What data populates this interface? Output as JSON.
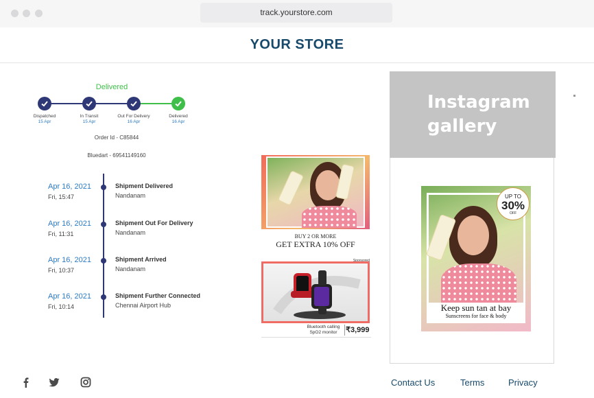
{
  "browser": {
    "url": "track.yourstore.com"
  },
  "header": {
    "brand": "YOUR STORE"
  },
  "tracker": {
    "status_label": "Delivered",
    "steps": [
      {
        "name": "Dispatched",
        "date": "15 Apr",
        "state": "done"
      },
      {
        "name": "In Transit",
        "date": "15 Apr",
        "state": "done"
      },
      {
        "name": "Out For Delivery",
        "date": "16 Apr",
        "state": "done"
      },
      {
        "name": "Delivered",
        "date": "16 Apr",
        "state": "delivered"
      }
    ],
    "order_id": "Order Id - C85844",
    "courier": "Bluedart - 69541149160",
    "colors": {
      "done": "#2f3876",
      "delivered": "#3fbf4a"
    }
  },
  "timeline": [
    {
      "date": "Apr 16, 2021",
      "time": "Fri, 15:47",
      "title": "Shipment Delivered",
      "place": "Nandanam"
    },
    {
      "date": "Apr 16, 2021",
      "time": "Fri, 11:31",
      "title": "Shipment Out For Delivery",
      "place": "Nandanam"
    },
    {
      "date": "Apr 16, 2021",
      "time": "Fri, 10:37",
      "title": "Shipment Arrived",
      "place": "Nandanam"
    },
    {
      "date": "Apr 16, 2021",
      "time": "Fri, 10:14",
      "title": "Shipment Further Connected",
      "place": "Chennai Airport Hub"
    }
  ],
  "ads": {
    "sunscreen": {
      "line1": "BUY 2 OR MORE",
      "line2": "GET EXTRA 10% OFF"
    },
    "watch": {
      "sponsored": "Sponsored",
      "caption_line1": "Bluetooth calling",
      "caption_line2": "SpO2 monitor",
      "price": "₹3,999"
    }
  },
  "instagram": {
    "title": "Instagram gallery",
    "post": {
      "badge_top": "UP TO",
      "badge_pct": "30%",
      "badge_off": "OFF",
      "caption": "Keep sun tan at bay",
      "subcaption": "Sunscreens for face & body"
    }
  },
  "footer": {
    "social": [
      "facebook-icon",
      "twitter-icon",
      "instagram-icon"
    ],
    "links": [
      "Contact Us",
      "Terms",
      "Privacy"
    ]
  }
}
